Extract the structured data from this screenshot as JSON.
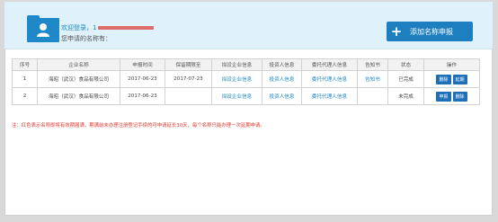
{
  "header": {
    "welcome": "欢迎登录，1",
    "names_label": "您申请的名称有：",
    "add_button_label": "添加名称申报",
    "accent": "#1e88c9",
    "button_color": "#1e7fc0"
  },
  "table": {
    "columns": [
      "序号",
      "企业名称",
      "申报时间",
      "保留期限至",
      "拟设企业信息",
      "投资人信息",
      "委托代理人信息",
      "告知书",
      "状态",
      "操作"
    ],
    "rows": [
      {
        "index": "1",
        "name": "海昭（武汉）食品有限公司",
        "apply_date": "2017-06-23",
        "expire_date": "2017-07-23",
        "company_info": "拟设企业信息",
        "investor_info": "投资人信息",
        "agent_info": "委托代理人信息",
        "notice": "告知书",
        "status": "已完成",
        "actions": [
          "删除",
          "延期"
        ]
      },
      {
        "index": "2",
        "name": "海昭（武汉）食品有限公司",
        "apply_date": "2017-06-23",
        "expire_date": "",
        "company_info": "拟设企业信息",
        "investor_info": "投资人信息",
        "agent_info": "委托代理人信息",
        "notice": "",
        "status": "未完成",
        "actions": [
          "申报",
          "删除"
        ]
      }
    ]
  },
  "footer_notice": "注：红色表示名称即将有效期届满，期满前未办理注册登记手续的可申请延长30天，每个名称只能办理一次延期申请。",
  "colors": {
    "link": "#1e88c9",
    "notice": "#e0362b",
    "header_bg": "#dff2fb"
  }
}
